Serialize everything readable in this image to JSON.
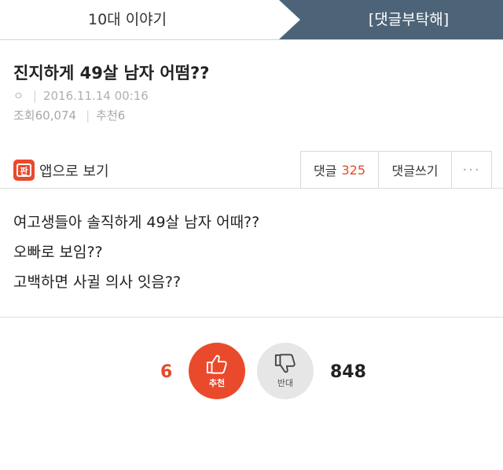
{
  "tabs": {
    "left_label": "10대 이야기",
    "right_label": "[댓글부탁해]"
  },
  "post": {
    "title": "진지하게 49살 남자 어떰??",
    "author_mark": "ㅇ",
    "date": "2016.11.14 00:16",
    "views_label": "조회",
    "views": "60,074",
    "recommend_label": "추천",
    "recommend": "6"
  },
  "app_view": {
    "label": "앱으로 보기",
    "icon_text": "판"
  },
  "actions": {
    "comments_label": "댓글",
    "comments_count": "325",
    "write_label": "댓글쓰기",
    "more_label": "···"
  },
  "body": {
    "lines": [
      "여고생들아 솔직하게 49살 남자 어때??",
      "오빠로 보임??",
      "고백하면 사귈 의사 잇음??"
    ]
  },
  "votes": {
    "up_count": "6",
    "up_label": "추천",
    "down_label": "반대",
    "down_count": "848"
  },
  "colors": {
    "accent_red": "#ea4a2c",
    "tab_bg": "#4d6478"
  }
}
